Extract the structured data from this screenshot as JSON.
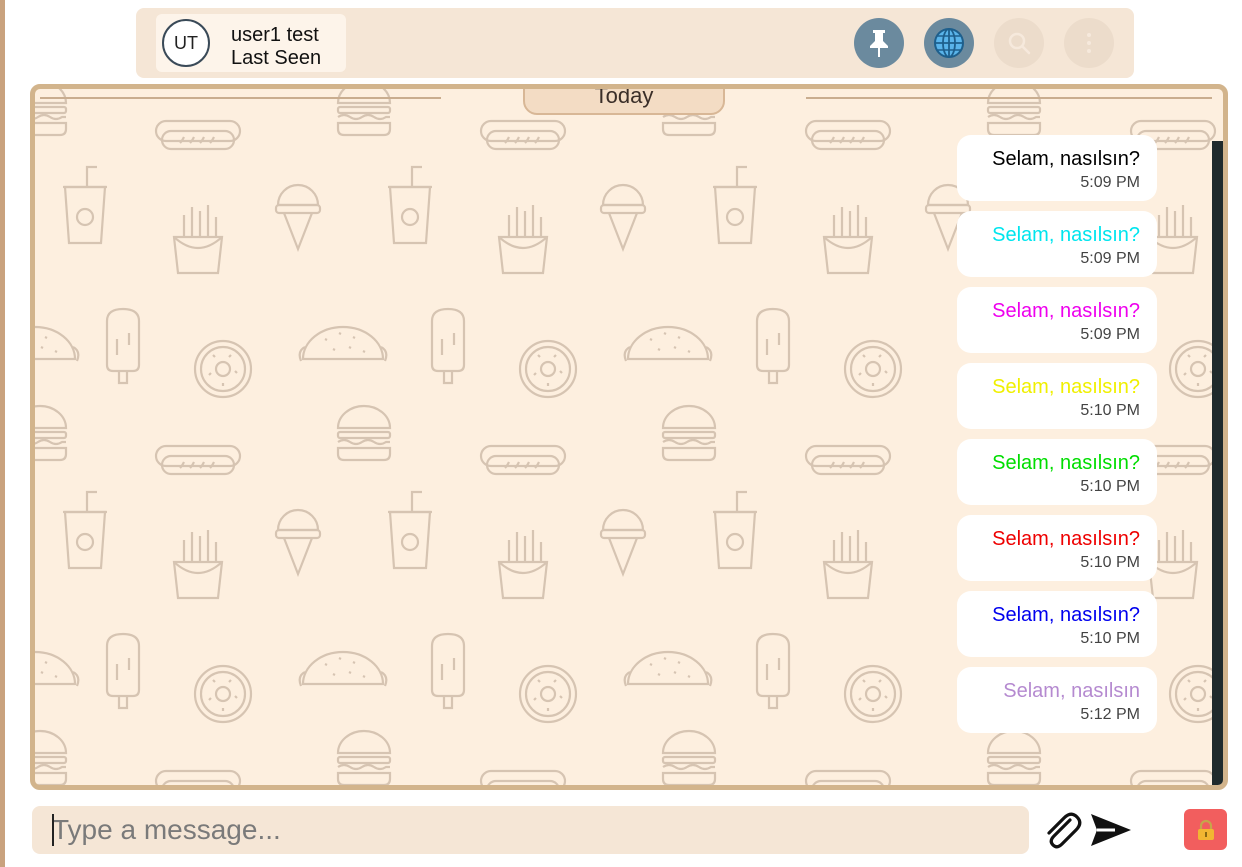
{
  "header": {
    "avatar_initials": "UT",
    "user_name": "user1 test",
    "user_status": "Last Seen",
    "buttons": [
      {
        "icon": "pin-icon",
        "state": "active"
      },
      {
        "icon": "globe-icon",
        "state": "active"
      },
      {
        "icon": "search-icon",
        "state": "disabled"
      },
      {
        "icon": "more-vertical-icon",
        "state": "disabled"
      }
    ]
  },
  "chat": {
    "date_separator": "Today",
    "background_color": "#fdefdf",
    "messages": [
      {
        "text": "Selam, nasılsın?",
        "time": "5:09 PM",
        "color": "#000000"
      },
      {
        "text": "Selam, nasılsın?",
        "time": "5:09 PM",
        "color": "#00e5ee"
      },
      {
        "text": "Selam, nasılsın?",
        "time": "5:09 PM",
        "color": "#ee00ee"
      },
      {
        "text": "Selam, nasılsın?",
        "time": "5:10 PM",
        "color": "#f0f000"
      },
      {
        "text": "Selam, nasılsın?",
        "time": "5:10 PM",
        "color": "#00dd00"
      },
      {
        "text": "Selam, nasılsın?",
        "time": "5:10 PM",
        "color": "#ee0000"
      },
      {
        "text": "Selam, nasılsın?",
        "time": "5:10 PM",
        "color": "#0000ee"
      },
      {
        "text": "Selam, nasılsın",
        "time": "5:12 PM",
        "color": "#b58ad0"
      }
    ]
  },
  "composer": {
    "placeholder": "Type a message...",
    "value": "",
    "attach_icon": "paperclip-icon",
    "send_icon": "send-icon",
    "lock_icon": "lock-icon",
    "lock_color": "#f25e5e"
  }
}
